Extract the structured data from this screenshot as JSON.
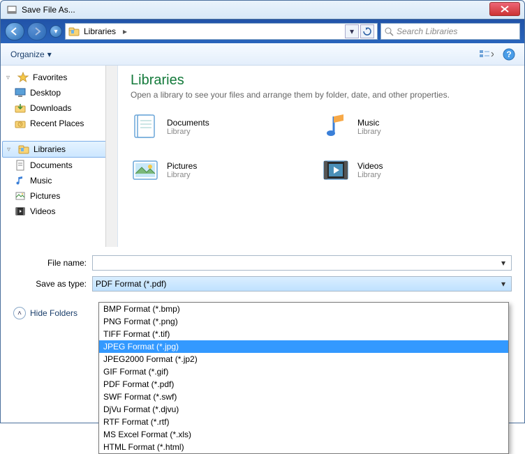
{
  "window": {
    "title": "Save File As..."
  },
  "nav": {
    "location_root_icon": "libraries-icon",
    "location": "Libraries",
    "search_placeholder": "Search Libraries"
  },
  "toolbar": {
    "organize": "Organize"
  },
  "sidebar": {
    "favorites": {
      "label": "Favorites",
      "items": [
        "Desktop",
        "Downloads",
        "Recent Places"
      ]
    },
    "libraries": {
      "label": "Libraries",
      "items": [
        "Documents",
        "Music",
        "Pictures",
        "Videos"
      ]
    }
  },
  "main": {
    "title": "Libraries",
    "subtitle": "Open a library to see your files and arrange them by folder, date, and other properties.",
    "items": [
      {
        "name": "Documents",
        "sub": "Library"
      },
      {
        "name": "Music",
        "sub": "Library"
      },
      {
        "name": "Pictures",
        "sub": "Library"
      },
      {
        "name": "Videos",
        "sub": "Library"
      }
    ]
  },
  "form": {
    "filename_label": "File name:",
    "filename_value": "",
    "saveastype_label": "Save as type:",
    "saveastype_value": "PDF Format (*.pdf)",
    "hide_folders": "Hide Folders"
  },
  "dropdown": {
    "options": [
      "BMP Format (*.bmp)",
      "PNG Format (*.png)",
      "TIFF Format (*.tif)",
      "JPEG Format (*.jpg)",
      "JPEG2000 Format (*.jp2)",
      "GIF Format (*.gif)",
      "PDF Format (*.pdf)",
      "SWF Format (*.swf)",
      "DjVu Format (*.djvu)",
      "RTF Format (*.rtf)",
      "MS Excel Format (*.xls)",
      "HTML Format (*.html)"
    ],
    "highlighted_index": 3
  }
}
